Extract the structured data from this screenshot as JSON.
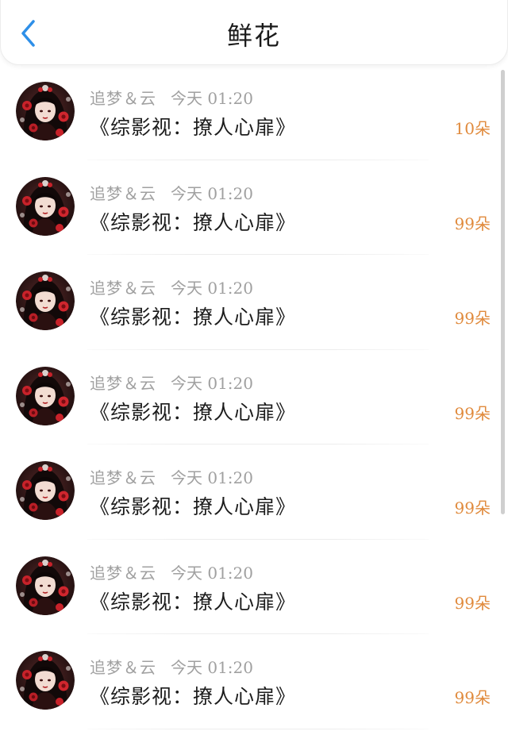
{
  "header": {
    "title": "鲜花",
    "back_icon": "chevron-left-icon"
  },
  "colors": {
    "accent_blue": "#2e8fe8",
    "count_orange": "#e08a3c",
    "meta_gray": "#a0a0a0"
  },
  "rows": [
    {
      "author": "追梦＆云",
      "time": "今天 01:20",
      "title": "《综影视：撩人心扉》",
      "count": "10朵"
    },
    {
      "author": "追梦＆云",
      "time": "今天 01:20",
      "title": "《综影视：撩人心扉》",
      "count": "99朵"
    },
    {
      "author": "追梦＆云",
      "time": "今天 01:20",
      "title": "《综影视：撩人心扉》",
      "count": "99朵"
    },
    {
      "author": "追梦＆云",
      "time": "今天 01:20",
      "title": "《综影视：撩人心扉》",
      "count": "99朵"
    },
    {
      "author": "追梦＆云",
      "time": "今天 01:20",
      "title": "《综影视：撩人心扉》",
      "count": "99朵"
    },
    {
      "author": "追梦＆云",
      "time": "今天 01:20",
      "title": "《综影视：撩人心扉》",
      "count": "99朵"
    },
    {
      "author": "追梦＆云",
      "time": "今天 01:20",
      "title": "《综影视：撩人心扉》",
      "count": "99朵"
    }
  ]
}
